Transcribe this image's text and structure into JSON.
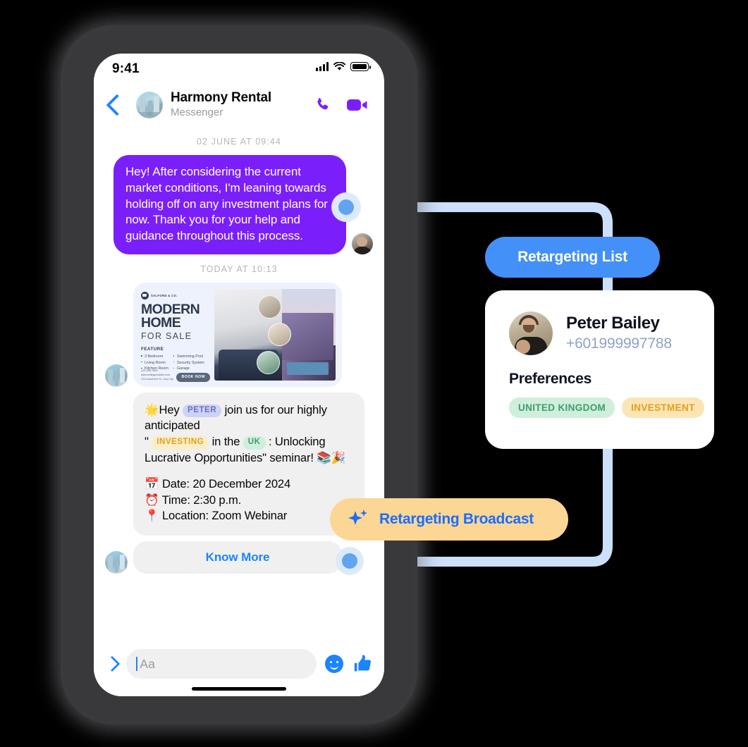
{
  "phone": {
    "status_bar": {
      "time": "9:41",
      "signal_icon": "signal-bars-icon",
      "wifi_icon": "wifi-icon",
      "battery_icon": "battery-icon"
    },
    "chat_header": {
      "back_icon": "back-chevron-icon",
      "avatar_icon": "contact-avatar",
      "name": "Harmony Rental",
      "subtitle": "Messenger",
      "call_icon": "phone-call-icon",
      "video_icon": "video-call-icon"
    },
    "thread": {
      "daystamp_1": "02 JUNE AT 09:44",
      "outgoing_message": "Hey! After considering the current market conditions, I'm leaning towards holding off on any investment plans for now. Thank you for your help and guidance throughout this process.",
      "daystamp_2": "TODAY AT 10:13",
      "flyer": {
        "brand": "SALFORD & CO.",
        "title_line1": "MODERN",
        "title_line2": "HOME",
        "subtitle": "FOR SALE",
        "feature_heading": "FEATURE",
        "features_col1": [
          "3 Bedroom",
          "Living Room",
          "Kitchen Room"
        ],
        "features_col2": [
          "Swimming Pool",
          "Security System",
          "Garage"
        ],
        "contact": "123-456-7890\nwww.reallygreatsite.com\n123 Anywhere St., Any City",
        "cta": "BOOK NOW"
      },
      "broadcast_message": {
        "line1_pre": "🌟Hey ",
        "tag_peter": "PETER",
        "line1_post": " join us for our highly anticipated",
        "line2_quote": "\"",
        "tag_investing": "INVESTING",
        "line2_mid": " in the ",
        "tag_uk": "UK",
        "line2_colon": " :",
        "line3": "Unlocking Lucrative Opportunities\" seminar! 📚🎉",
        "date_line": "📅 Date: 20 December 2024",
        "time_line": "⏰ Time: 2:30 p.m.",
        "location_line": "📍 Location: Zoom Webinar"
      },
      "know_more_label": "Know More"
    },
    "composer": {
      "expand_icon": "chevron-right-icon",
      "input_placeholder": "Aa",
      "input_value": "",
      "emoji_icon": "smiley-face-icon",
      "like_icon": "thumbs-up-icon"
    }
  },
  "annotations": {
    "retargeting_list_badge": "Retargeting List",
    "retargeting_broadcast_badge": "Retargeting Broadcast",
    "sparkle_icon": "sparkle-icon",
    "person_card": {
      "avatar_icon": "person-avatar",
      "name": "Peter Bailey",
      "phone": "+601999997788",
      "preferences_heading": "Preferences",
      "tags": [
        "UNITED KINGDOM",
        "INVESTMENT"
      ]
    }
  },
  "colors": {
    "purple_bubble": "#7b1ffa",
    "messenger_blue": "#1b84ff",
    "badge_blue": "#4290f8",
    "badge_amber": "#fcd694",
    "connector_line": "#ccdffb",
    "connector_dot": "#62a4f0",
    "tag_green_bg": "#cfeedb",
    "tag_green_fg": "#3e9e6b",
    "tag_amber_bg": "#fbe5b4",
    "tag_amber_fg": "#e0a020",
    "tag_lavender_bg": "#ccd3f7",
    "tag_lavender_fg": "#6b71b8"
  }
}
